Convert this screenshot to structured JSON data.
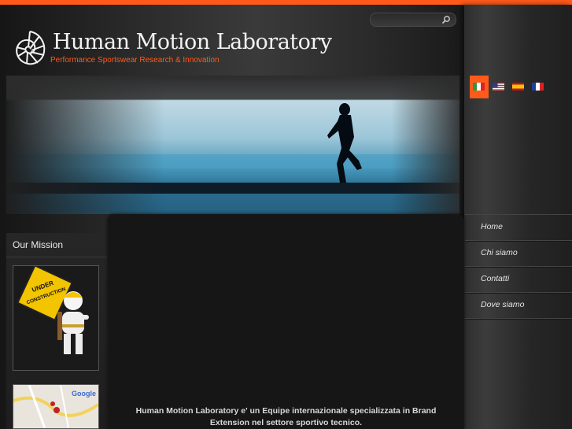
{
  "header": {
    "title": "Human Motion Laboratory",
    "tagline": "Performance Sportswear Research & Innovation"
  },
  "search": {
    "placeholder": "",
    "icon": "magnifier-icon"
  },
  "languages": [
    {
      "code": "it",
      "active": true
    },
    {
      "code": "en-us",
      "active": false
    },
    {
      "code": "es",
      "active": false
    },
    {
      "code": "fr",
      "active": false
    }
  ],
  "sidebar": {
    "title": "Our Mission",
    "thumb_caption": [
      "UNDER",
      "CONSTRUCTION"
    ],
    "map_brand": "Google"
  },
  "main": {
    "text_line1": "Human Motion Laboratory e' un Equipe internazionale specializzata in Brand",
    "text_line2": "Extension nel settore sportivo tecnico."
  },
  "nav": {
    "items": [
      {
        "label": "Home"
      },
      {
        "label": "Chi siamo"
      },
      {
        "label": "Contatti"
      },
      {
        "label": "Dove siamo"
      }
    ]
  },
  "colors": {
    "accent": "#ff5a1a",
    "background": "#1c1c1c"
  }
}
